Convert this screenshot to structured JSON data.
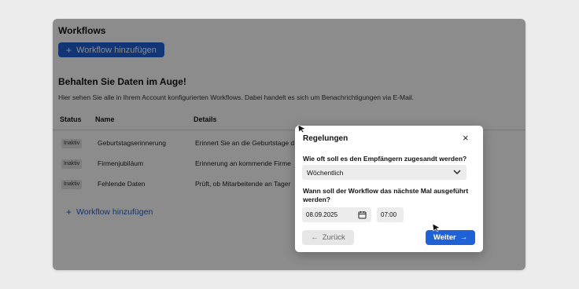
{
  "app": {
    "title": "Workflows",
    "add_button_label": "Workflow hinzufügen",
    "section_title": "Behalten Sie Daten im Auge!",
    "section_description": "Hier sehen Sie alle in Ihrem Account konfigurierten Workflows. Dabei handelt es sich um Benachrichtigungen via E-Mail.",
    "table": {
      "columns": [
        "Status",
        "Name",
        "Details"
      ],
      "rows": [
        {
          "status": "Inaktiv",
          "name": "Geburtstagserinnerung",
          "details": "Erinnert Sie an die Geburtstage d"
        },
        {
          "status": "Inaktiv",
          "name": "Firmenjubiläum",
          "details": "Erinnerung an kommende Firme"
        },
        {
          "status": "Inaktiv",
          "name": "Fehlende Daten",
          "details": "Prüft, ob Mitarbeitende an Tager"
        }
      ]
    },
    "add_link_label": "Workflow hinzufügen"
  },
  "modal": {
    "title": "Regelungen",
    "close_icon": "close-icon",
    "question_frequency": "Wie oft soll es den Empfängern zugesandt werden?",
    "frequency_value": "Wöchentlich",
    "question_next_run": "Wann soll der Workflow das nächste Mal ausgeführt werden?",
    "date_value": "08.09.2025",
    "time_value": "07:00",
    "back_label": "Zurück",
    "next_label": "Weiter"
  },
  "colors": {
    "primary": "#1f62d6",
    "overlay": "rgba(0,0,0,0.45)"
  }
}
